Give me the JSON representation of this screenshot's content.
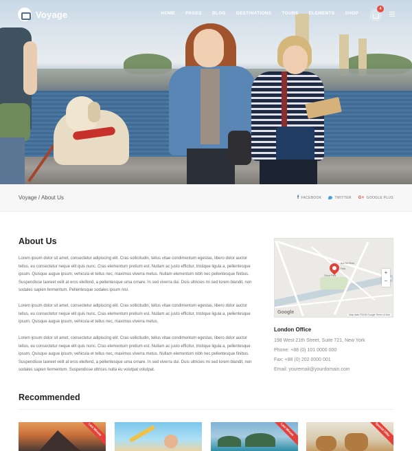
{
  "brand": {
    "name": "Voyage"
  },
  "nav": {
    "items": [
      "HOME",
      "PAGES",
      "BLOG",
      "DESTINATIONS",
      "TOURS",
      "ELEMENTS",
      "SHOP"
    ],
    "cart_count": "4"
  },
  "breadcrumb": {
    "home": "Voyage",
    "separator": " / ",
    "current": "About Us"
  },
  "share": {
    "facebook": "FACEBOOK",
    "twitter": "TWITTER",
    "google": "GOOGLE PLUS"
  },
  "about": {
    "title": "About Us",
    "paragraphs": [
      "Lorem ipsum dolor sit amet, consectetur adipiscing elit. Cras sollicitudin, tellus vitae condimentum egestas, libero dolor auctor tellus, eu consectetur neque elit quis nunc. Cras elementum pretium est. Nullam ac justo efficitur, tristique ligula a, pellentesque ipsum. Quisque augue ipsum, vehicula et tellus nec, maximus viverra metus. Nullam elementum nibh nec pellentesque finibus. Suspendisse laoreet velit at eros eleifend, a pellentesque urna ornare. In sed viverra dui. Duis ultricies mi sed lorem blandit, non sodales sapien fermentum. Pellentesque sodales ipsum nisi.",
      "Lorem ipsum dolor sit amet, consectetur adipiscing elit. Cras sollicitudin, tellus vitae condimentum egestas, libero dolor auctor tellus, eu consectetur neque elit quis nunc. Cras elementum pretium est. Nullam ac justo efficitur, tristique ligula a, pellentesque ipsum. Quisque augue ipsum, vehicula et tellus nec, maximus viverra metus.",
      "Lorem ipsum dolor sit amet, consectetur adipiscing elit. Cras sollicitudin, tellus vitae condimentum egestas, libero dolor auctor tellus, eu consectetur neque elit quis nunc. Cras elementum pretium est. Nullam ac justo efficitur, tristique ligula a, pellentesque ipsum. Quisque augue ipsum, vehicula et tellus nec, maximus viverra metus. Nullam elementum nibh nec pellentesque finibus. Suspendisse laoreet velit at eros eleifend, a pellentesque urna ornare. In sed viverra dui. Duis ultricies mi sed lorem blandit, non sodales sapien fermentum. Suspendisse ultrices nulla eu volutpat volutpat."
    ]
  },
  "map": {
    "zoom_in": "+",
    "zoom_out": "−",
    "logo": "Google",
    "attribution": "Map data ©2018 Google   Terms of Use",
    "labels": [
      "Ace Mr Shen",
      "Park",
      "Cloud Park"
    ]
  },
  "office": {
    "title": "London Office",
    "address": "198 West 21th Street, Suite 721, New York",
    "phone": "Phone: +88 (0) 101 0000 000",
    "fax": "Fax: +88 (0) 202 0000 001",
    "email": "Email: youremail@yourdomain.com"
  },
  "recommended": {
    "title": "Recommended",
    "cards": [
      {
        "badge": "Last Minute"
      },
      {
        "badge": ""
      },
      {
        "badge": "Last Minute"
      },
      {
        "badge": "Special Offer"
      }
    ]
  },
  "colors": {
    "accent": "#e3413a",
    "text": "#333333",
    "muted": "#888888"
  }
}
